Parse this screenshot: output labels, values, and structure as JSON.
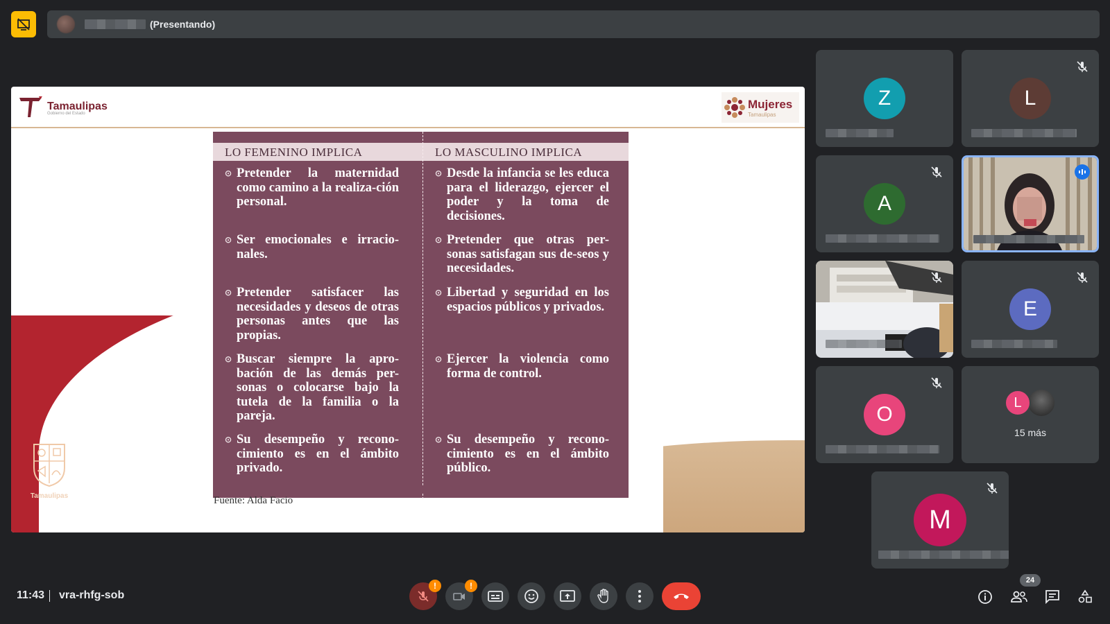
{
  "header": {
    "presenting_label": "(Presentando)"
  },
  "slide": {
    "logo_left": "Tamaulipas",
    "logo_left_sub": "Gobierno del Estado",
    "logo_right": "Mujeres",
    "logo_right_sub": "Tamaulipas",
    "crest_label": "Tamaulipas",
    "col_left_head": "LO FEMENINO IMPLICA",
    "col_right_head": "LO MASCULINO IMPLICA",
    "left_items": [
      "Pretender la maternidad como camino a la realiza-ción personal.",
      "Ser emocionales e irracio-nales.",
      "Pretender satisfacer las necesidades y deseos de otras personas antes que las propias.",
      "Buscar siempre la apro-bación de las demás per-sonas o colocarse bajo la tutela de la familia o la pareja.",
      "Su desempeño y recono-cimiento es en el ámbito privado."
    ],
    "right_items": [
      "Desde la infancia se les educa para el liderazgo, ejercer el poder y la toma de decisiones.",
      "Pretender que otras per-sonas satisfagan sus de-seos y necesidades.",
      "Libertad y seguridad en los espacios públicos y privados.",
      "Ejercer la violencia como forma de control.",
      "Su desempeño y recono-cimiento es en el ámbito público."
    ],
    "source": "Fuente: Alda Facio"
  },
  "participants": [
    {
      "initial": "Z",
      "color": "#129eaf",
      "muted": false
    },
    {
      "initial": "L",
      "color": "#5d3c35",
      "muted": true
    },
    {
      "initial": "A",
      "color": "#2e6b30",
      "muted": true
    },
    {
      "initial": "",
      "color": "",
      "muted": false,
      "video": true,
      "speaking": true
    },
    {
      "initial": "",
      "color": "",
      "muted": true,
      "video": true
    },
    {
      "initial": "E",
      "color": "#5c6bc0",
      "muted": true
    },
    {
      "initial": "O",
      "color": "#e8457b",
      "muted": true
    },
    {
      "initial": "L",
      "color": "#e8457b",
      "more_label": "15 más"
    },
    {
      "initial": "M",
      "color": "#c2185b",
      "muted": true
    }
  ],
  "footer": {
    "time": "11:43",
    "meeting_code": "vra-rhfg-sob",
    "people_count": "24",
    "warning_mark": "!"
  },
  "colors": {
    "end_call": "#ea4335",
    "presenting_accent": "#fbbc04",
    "slide_table": "#7b4a5e"
  }
}
